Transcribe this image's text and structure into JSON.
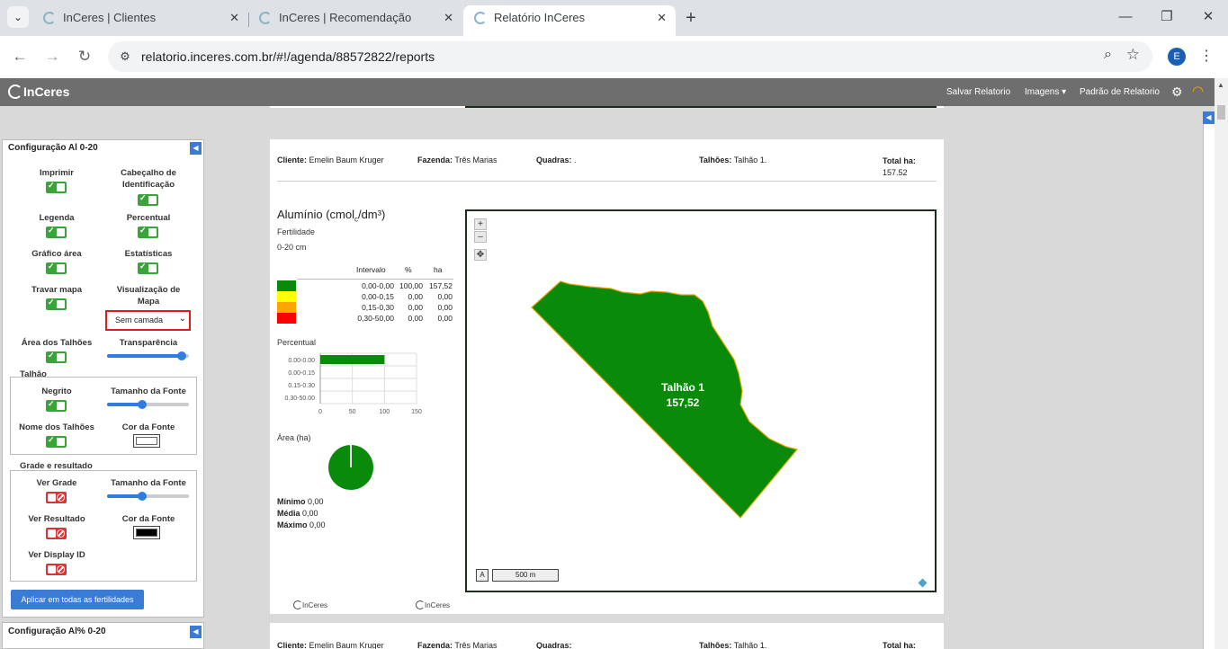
{
  "browser": {
    "tabs": [
      {
        "label": "InCeres | Clientes"
      },
      {
        "label": "InCeres | Recomendação"
      },
      {
        "label": "Relatório InCeres"
      }
    ],
    "url": "relatorio.inceres.com.br/#!/agenda/88572822/reports",
    "profile_initial": "E"
  },
  "app": {
    "logo": "InCeres",
    "nav": {
      "save": "Salvar Relatorio",
      "images": "Imagens",
      "default": "Padrão de Relatorio"
    }
  },
  "config": {
    "title": "Configuração Al 0-20",
    "labels": {
      "print": "Imprimir",
      "header": "Cabeçalho de Identificação",
      "legend": "Legenda",
      "percent": "Percentual",
      "area_chart": "Gráfico área",
      "stats": "Estatísticas",
      "lock_map": "Travar mapa",
      "map_view": "Visualização de Mapa",
      "plot_area": "Área dos Talhões",
      "transparency": "Transparência"
    },
    "map_layer_select": "Sem camada",
    "talhao_group": {
      "title": "Talhão",
      "bold": "Negrito",
      "font_size": "Tamanho da Fonte",
      "names": "Nome dos Talhões",
      "font_color": "Cor da Fonte"
    },
    "grid_group": {
      "title": "Grade e resultado",
      "show_grid": "Ver Grade",
      "font_size": "Tamanho da Fonte",
      "show_result": "Ver Resultado",
      "font_color": "Cor da Fonte",
      "show_display_id": "Ver Display ID"
    },
    "apply_button": "Aplicar em todas as fertilidades",
    "next_title": "Configuração Al% 0-20",
    "toggle_state": {
      "print": true,
      "header": true,
      "legend": true,
      "percent": true,
      "area_chart": true,
      "stats": true,
      "lock_map": true,
      "plot_area": true,
      "bold": true,
      "names": true,
      "show_grid": false,
      "show_result": false,
      "show_display_id": false
    },
    "slider_levels": {
      "transparency": 0.95,
      "talhao_font": 0.4,
      "grid_font": 0.4
    },
    "colors": {
      "talhao_font": "#ffffff",
      "grid_font": "#000000"
    }
  },
  "report": {
    "labels": {
      "client": "Cliente:",
      "farm": "Fazenda:",
      "blocks": "Quadras:",
      "plots": "Talhões:",
      "total": "Total ha:"
    },
    "values": {
      "client": "Emelin Baum Kruger",
      "farm": "Três Marias",
      "blocks": ".",
      "plots": "Talhão 1.",
      "total": "157.52"
    },
    "title_main": "Alumínio (cmol",
    "title_sub": "c",
    "title_end": "/dm³)",
    "subtitle": "Fertilidade",
    "depth": "0-20 cm",
    "legend_headers": {
      "interval": "Intervalo",
      "pct": "%",
      "ha": "ha"
    },
    "legend_rows": [
      {
        "color": "#0a8a0a",
        "interval": "0,00-0,00",
        "pct": "100,00",
        "ha": "157,52"
      },
      {
        "color": "#ffff00",
        "interval": "0,00-0,15",
        "pct": "0,00",
        "ha": "0,00"
      },
      {
        "color": "#ffa500",
        "interval": "0,15-0,30",
        "pct": "0,00",
        "ha": "0,00"
      },
      {
        "color": "#ff0000",
        "interval": "0,30-50,00",
        "pct": "0,00",
        "ha": "0,00"
      }
    ],
    "percent_label": "Percentual",
    "area_label": "Área (ha)",
    "stats": {
      "min_label": "Mínimo",
      "min": "0,00",
      "avg_label": "Média",
      "avg": "0,00",
      "max_label": "Máximo",
      "max": "0,00"
    },
    "map_label_name": "Talhão 1",
    "map_label_area": "157,52",
    "scale": "500 m",
    "north": "A",
    "footer_logo": "InCeres"
  },
  "chart_data": {
    "type": "bar",
    "categories": [
      "0.00-0.00",
      "0.00-0.15",
      "0.15-0.30",
      "0.30-50.00"
    ],
    "values": [
      100,
      0,
      0,
      0
    ],
    "xticks": [
      "0",
      "50",
      "100",
      "150"
    ],
    "xlim": [
      0,
      150
    ],
    "orientation": "horizontal",
    "grid": true,
    "color": "#0a8a0a"
  }
}
